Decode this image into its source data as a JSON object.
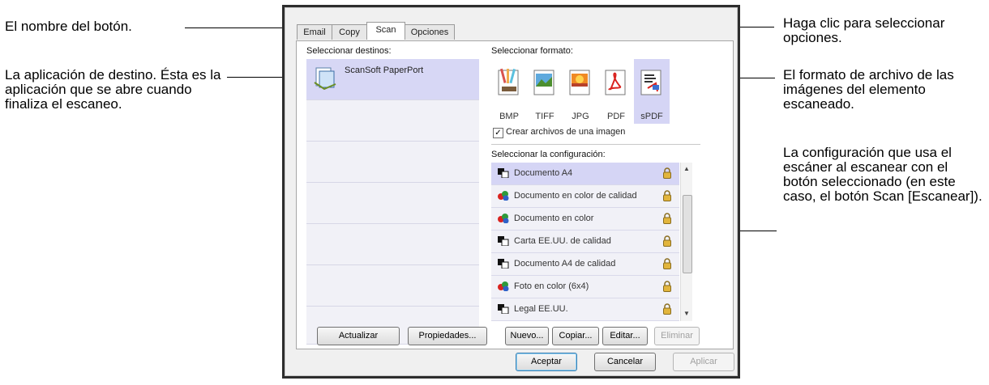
{
  "callouts": {
    "button_name": "El nombre del botón.",
    "destination_app": "La aplicación de destino. Ésta es la aplicación que se abre cuando finaliza el escaneo.",
    "options": "Haga clic para seleccionar opciones.",
    "file_format": "El formato de archivo de las imágenes del elemento escaneado.",
    "config": "La configuración que usa el escáner al escanear con el botón seleccionado (en este caso, el botón Scan [Escanear])."
  },
  "tabs": [
    {
      "label": "Email"
    },
    {
      "label": "Copy"
    },
    {
      "label": "Scan"
    },
    {
      "label": "Opciones"
    }
  ],
  "destinations": {
    "heading": "Seleccionar destinos:",
    "items": [
      {
        "label": "ScanSoft PaperPort"
      }
    ]
  },
  "formats": {
    "heading": "Seleccionar formato:",
    "items": [
      {
        "label": "BMP",
        "icon": "paint-icon"
      },
      {
        "label": "TIFF",
        "icon": "tiff-image-icon"
      },
      {
        "label": "JPG",
        "icon": "jpg-image-icon"
      },
      {
        "label": "PDF",
        "icon": "pdf-icon"
      },
      {
        "label": "sPDF",
        "icon": "searchable-pdf-icon",
        "selected": true
      }
    ],
    "single_image_label": "Crear archivos de una imagen",
    "single_image_checked": true
  },
  "configurations": {
    "heading": "Seleccionar la configuración:",
    "items": [
      {
        "label": "Documento A4",
        "icon": "bw-document-icon"
      },
      {
        "label": "Documento en color de calidad",
        "icon": "color-document-icon"
      },
      {
        "label": "Documento en color",
        "icon": "color-document-icon"
      },
      {
        "label": "Carta EE.UU. de calidad",
        "icon": "bw-document-icon"
      },
      {
        "label": "Documento A4 de calidad",
        "icon": "bw-document-icon"
      },
      {
        "label": "Foto en color (6x4)",
        "icon": "color-document-icon"
      },
      {
        "label": "Legal EE.UU.",
        "icon": "bw-document-icon"
      }
    ]
  },
  "buttons": {
    "refresh": "Actualizar",
    "properties": "Propiedades...",
    "new": "Nuevo...",
    "copy": "Copiar...",
    "edit": "Editar...",
    "delete": "Eliminar",
    "ok": "Aceptar",
    "cancel": "Cancelar",
    "apply": "Aplicar"
  },
  "colors": {
    "selection": "#d5d5f5",
    "list_background": "#f1f1f7",
    "lock": "#e2b53c"
  }
}
